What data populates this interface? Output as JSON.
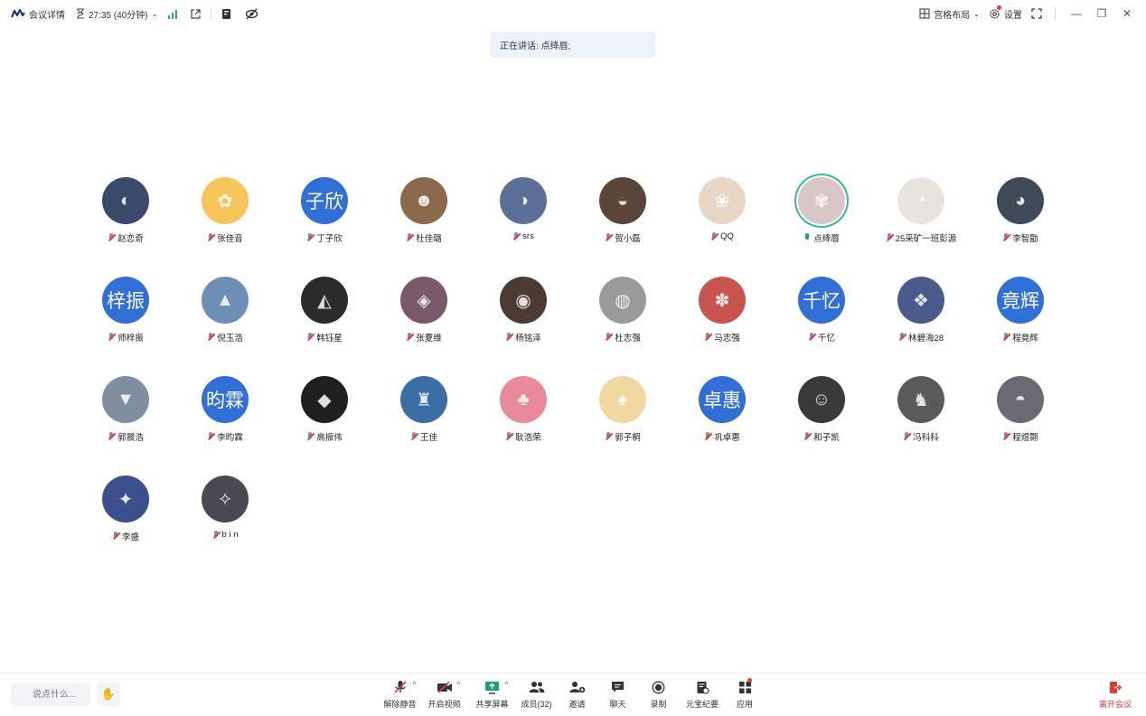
{
  "topbar": {
    "meeting_details": "会议详情",
    "timer": "27:35 (40分钟)",
    "layout_label": "宫格布局",
    "settings_label": "设置"
  },
  "speaking": {
    "text": "正在讲话: 点绛唇;"
  },
  "participants": [
    {
      "name": "赵恋奇",
      "mic": "muted",
      "avatar": {
        "type": "photo",
        "color": "#3a4a6b",
        "glyph": "◐"
      }
    },
    {
      "name": "张佳音",
      "mic": "muted",
      "avatar": {
        "type": "photo",
        "color": "#f7c65a",
        "glyph": "✿"
      }
    },
    {
      "name": "丁子欣",
      "mic": "muted",
      "avatar": {
        "type": "text",
        "text": "子欣",
        "color": "#2f6fd6"
      }
    },
    {
      "name": "杜佳璐",
      "mic": "muted",
      "avatar": {
        "type": "photo",
        "color": "#8a6a4a",
        "glyph": "☻"
      }
    },
    {
      "name": "srs",
      "mic": "muted",
      "avatar": {
        "type": "photo",
        "color": "#5c6f99",
        "glyph": "◑"
      }
    },
    {
      "name": "贺小磊",
      "mic": "muted",
      "avatar": {
        "type": "photo",
        "color": "#5a4538",
        "glyph": "◒"
      }
    },
    {
      "name": "QQ",
      "mic": "muted",
      "avatar": {
        "type": "photo",
        "color": "#e8d6c6",
        "glyph": "❀"
      }
    },
    {
      "name": "点绛唇",
      "mic": "speaking",
      "avatar": {
        "type": "photo",
        "color": "#d9c7c7",
        "glyph": "✾"
      }
    },
    {
      "name": "25采矿一班彭源",
      "mic": "muted",
      "avatar": {
        "type": "photo",
        "color": "#e9e4df",
        "glyph": "◔"
      }
    },
    {
      "name": "李智勖",
      "mic": "muted",
      "avatar": {
        "type": "photo",
        "color": "#3f4a59",
        "glyph": "◕"
      }
    },
    {
      "name": "师梓振",
      "mic": "muted",
      "avatar": {
        "type": "text",
        "text": "梓振",
        "color": "#2f6fd6"
      }
    },
    {
      "name": "倪玉浩",
      "mic": "muted",
      "avatar": {
        "type": "photo",
        "color": "#6e8fb5",
        "glyph": "▲"
      }
    },
    {
      "name": "韩钰星",
      "mic": "muted",
      "avatar": {
        "type": "photo",
        "color": "#2b2b2b",
        "glyph": "◭"
      }
    },
    {
      "name": "张夏维",
      "mic": "muted",
      "avatar": {
        "type": "photo",
        "color": "#7a5a6a",
        "glyph": "◈"
      }
    },
    {
      "name": "杨铭泽",
      "mic": "muted",
      "avatar": {
        "type": "photo",
        "color": "#4a3a32",
        "glyph": "◉"
      }
    },
    {
      "name": "杜志强",
      "mic": "muted",
      "avatar": {
        "type": "photo",
        "color": "#9a9a9a",
        "glyph": "◍"
      }
    },
    {
      "name": "马志强",
      "mic": "muted",
      "avatar": {
        "type": "photo",
        "color": "#c9534f",
        "glyph": "✽"
      }
    },
    {
      "name": "千忆",
      "mic": "muted",
      "avatar": {
        "type": "text",
        "text": "千忆",
        "color": "#2f6fd6"
      }
    },
    {
      "name": "林碧海28",
      "mic": "muted",
      "avatar": {
        "type": "photo",
        "color": "#4a5a8a",
        "glyph": "❖"
      }
    },
    {
      "name": "程竟辉",
      "mic": "muted",
      "avatar": {
        "type": "text",
        "text": "竟辉",
        "color": "#2f6fd6"
      }
    },
    {
      "name": "郭晨浩",
      "mic": "muted",
      "avatar": {
        "type": "photo",
        "color": "#7f8ea0",
        "glyph": "▼"
      }
    },
    {
      "name": "李昀霖",
      "mic": "muted",
      "avatar": {
        "type": "text",
        "text": "昀霖",
        "color": "#2f6fd6"
      }
    },
    {
      "name": "高振伟",
      "mic": "muted",
      "avatar": {
        "type": "photo",
        "color": "#1f1f1f",
        "glyph": "◆"
      }
    },
    {
      "name": "王佳",
      "mic": "muted",
      "avatar": {
        "type": "photo",
        "color": "#3b6ea5",
        "glyph": "♜"
      }
    },
    {
      "name": "耿浩荣",
      "mic": "muted",
      "avatar": {
        "type": "photo",
        "color": "#e88a9a",
        "glyph": "♣"
      }
    },
    {
      "name": "郭子桐",
      "mic": "muted",
      "avatar": {
        "type": "photo",
        "color": "#f0d9a0",
        "glyph": "♠"
      }
    },
    {
      "name": "巩卓惠",
      "mic": "muted",
      "avatar": {
        "type": "text",
        "text": "卓惠",
        "color": "#2f6fd6"
      }
    },
    {
      "name": "和子凯",
      "mic": "muted",
      "avatar": {
        "type": "photo",
        "color": "#3a3a3a",
        "glyph": "☺"
      }
    },
    {
      "name": "冯科科",
      "mic": "muted",
      "avatar": {
        "type": "photo",
        "color": "#5a5a5a",
        "glyph": "♞"
      }
    },
    {
      "name": "程煜翾",
      "mic": "muted",
      "avatar": {
        "type": "photo",
        "color": "#6a6a72",
        "glyph": "◓"
      }
    },
    {
      "name": "李盛",
      "mic": "muted",
      "avatar": {
        "type": "photo",
        "color": "#3a4f8c",
        "glyph": "✦"
      }
    },
    {
      "name": "b i n",
      "mic": "muted",
      "avatar": {
        "type": "photo",
        "color": "#4a4a52",
        "glyph": "✧"
      }
    }
  ],
  "bottombar": {
    "say_placeholder": "说点什么...",
    "controls": [
      {
        "label": "解除静音",
        "icon": "mic-off-icon",
        "caret": true
      },
      {
        "label": "开启视频",
        "icon": "video-off-icon",
        "caret": true
      },
      {
        "label": "共享屏幕",
        "icon": "share-screen-icon",
        "caret": true
      },
      {
        "label": "成员(32)",
        "icon": "members-icon",
        "caret": false
      },
      {
        "label": "邀请",
        "icon": "invite-icon",
        "caret": false
      },
      {
        "label": "聊天",
        "icon": "chat-icon",
        "caret": false
      },
      {
        "label": "录制",
        "icon": "record-icon",
        "caret": false
      },
      {
        "label": "元宝纪要",
        "icon": "minutes-icon",
        "caret": false
      },
      {
        "label": "应用",
        "icon": "apps-icon",
        "caret": false
      }
    ],
    "leave_label": "离开会议"
  },
  "colors": {
    "accent_blue": "#2f6fd6",
    "speaking_ring": "#36b89a",
    "leave_red": "#e23b3b",
    "signal_green": "#22b35e"
  }
}
